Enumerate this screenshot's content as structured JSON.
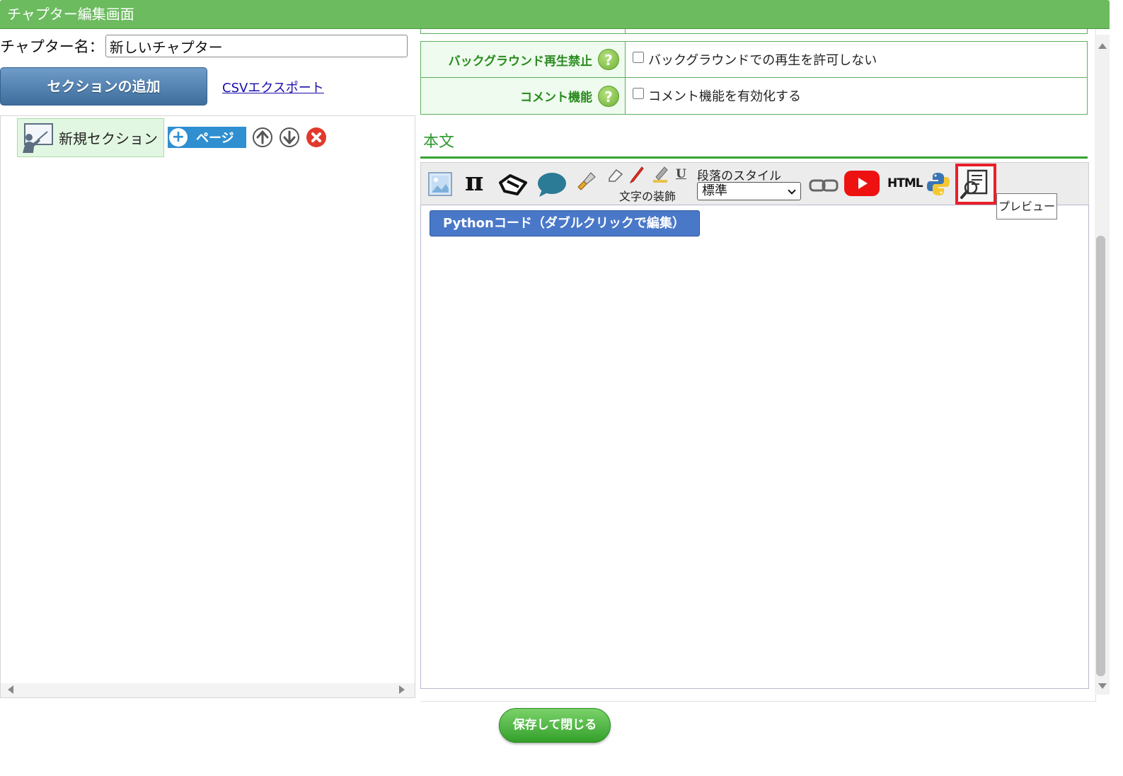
{
  "window": {
    "title": "チャプター編集画面"
  },
  "left": {
    "chapter_label": "チャプター名：",
    "chapter_name_value": "新しいチャプター",
    "add_section_label": "セクションの追加",
    "csv_export_label": "CSVエクスポート",
    "tree": {
      "section_label": "新規セクション",
      "add_page_label": "ページ"
    }
  },
  "settings": {
    "rows": [
      {
        "label": "バックグラウンド再生禁止",
        "checkbox_label": "バックグラウンドでの再生を許可しない",
        "checked": false
      },
      {
        "label": "コメント機能",
        "checkbox_label": "コメント機能を有効化する",
        "checked": false
      }
    ]
  },
  "editor": {
    "heading": "本文",
    "toolbar": {
      "decoration_label": "文字の装飾",
      "paragraph_style_label": "段落のスタイル",
      "paragraph_style_value": "標準",
      "html_label": "HTML",
      "underline_label": "U",
      "pi_label": "π"
    },
    "python_block_label": "Pythonコード（ダブルクリックで編集）",
    "tooltip": "プレビュー"
  },
  "footer": {
    "save_close_label": "保存して閉じる"
  },
  "colors": {
    "titlebar": "#6cbb5f",
    "accent_green": "#2e9a2e",
    "section_button": "#3e6d9c",
    "preview_highlight": "#e8202a"
  }
}
